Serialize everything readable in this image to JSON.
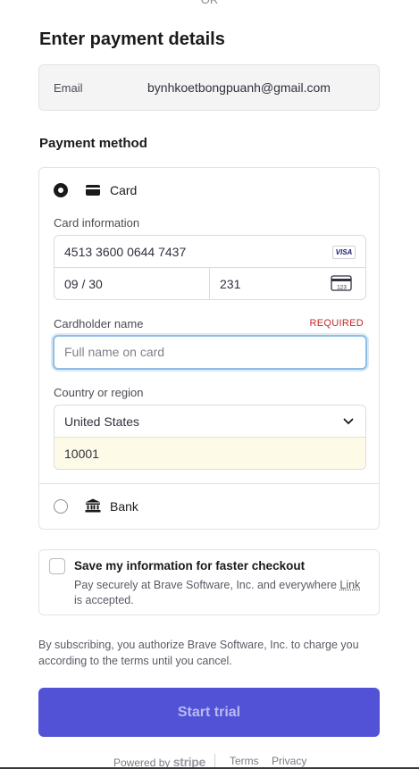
{
  "top_divider_text": "OR",
  "title": "Enter payment details",
  "email": {
    "label": "Email",
    "value": "bynhkoetbongpuanh@gmail.com"
  },
  "payment_method": {
    "label": "Payment method",
    "card_option": {
      "label": "Card",
      "selected": true,
      "card_information_label": "Card information",
      "card_number": "4513 3600 0644 7437",
      "card_brand": "VISA",
      "expiry": "09 / 30",
      "cvc": "231",
      "cvc_icon_text": "123",
      "cardholder_label": "Cardholder name",
      "required_text": "REQUIRED",
      "cardholder_placeholder": "Full name on card",
      "country_label": "Country or region",
      "country_value": "United States",
      "zip_value": "10001"
    },
    "bank_option": {
      "label": "Bank",
      "selected": false
    }
  },
  "save_info": {
    "title": "Save my information for faster checkout",
    "desc_before": "Pay securely at Brave Software, Inc. and everywhere ",
    "desc_link": "Link",
    "desc_after": " is accepted."
  },
  "subscription_notice": "By subscribing, you authorize Brave Software, Inc. to charge you according to the terms until you cancel.",
  "start_button": "Start trial",
  "footer": {
    "powered_by": "Powered by",
    "stripe": "stripe",
    "terms": "Terms",
    "privacy": "Privacy"
  },
  "colors": {
    "primary_button": "#5152d5",
    "focus_border": "#8bbee8",
    "required": "#c02a2a",
    "autofill_bg": "#fdfbe8"
  }
}
